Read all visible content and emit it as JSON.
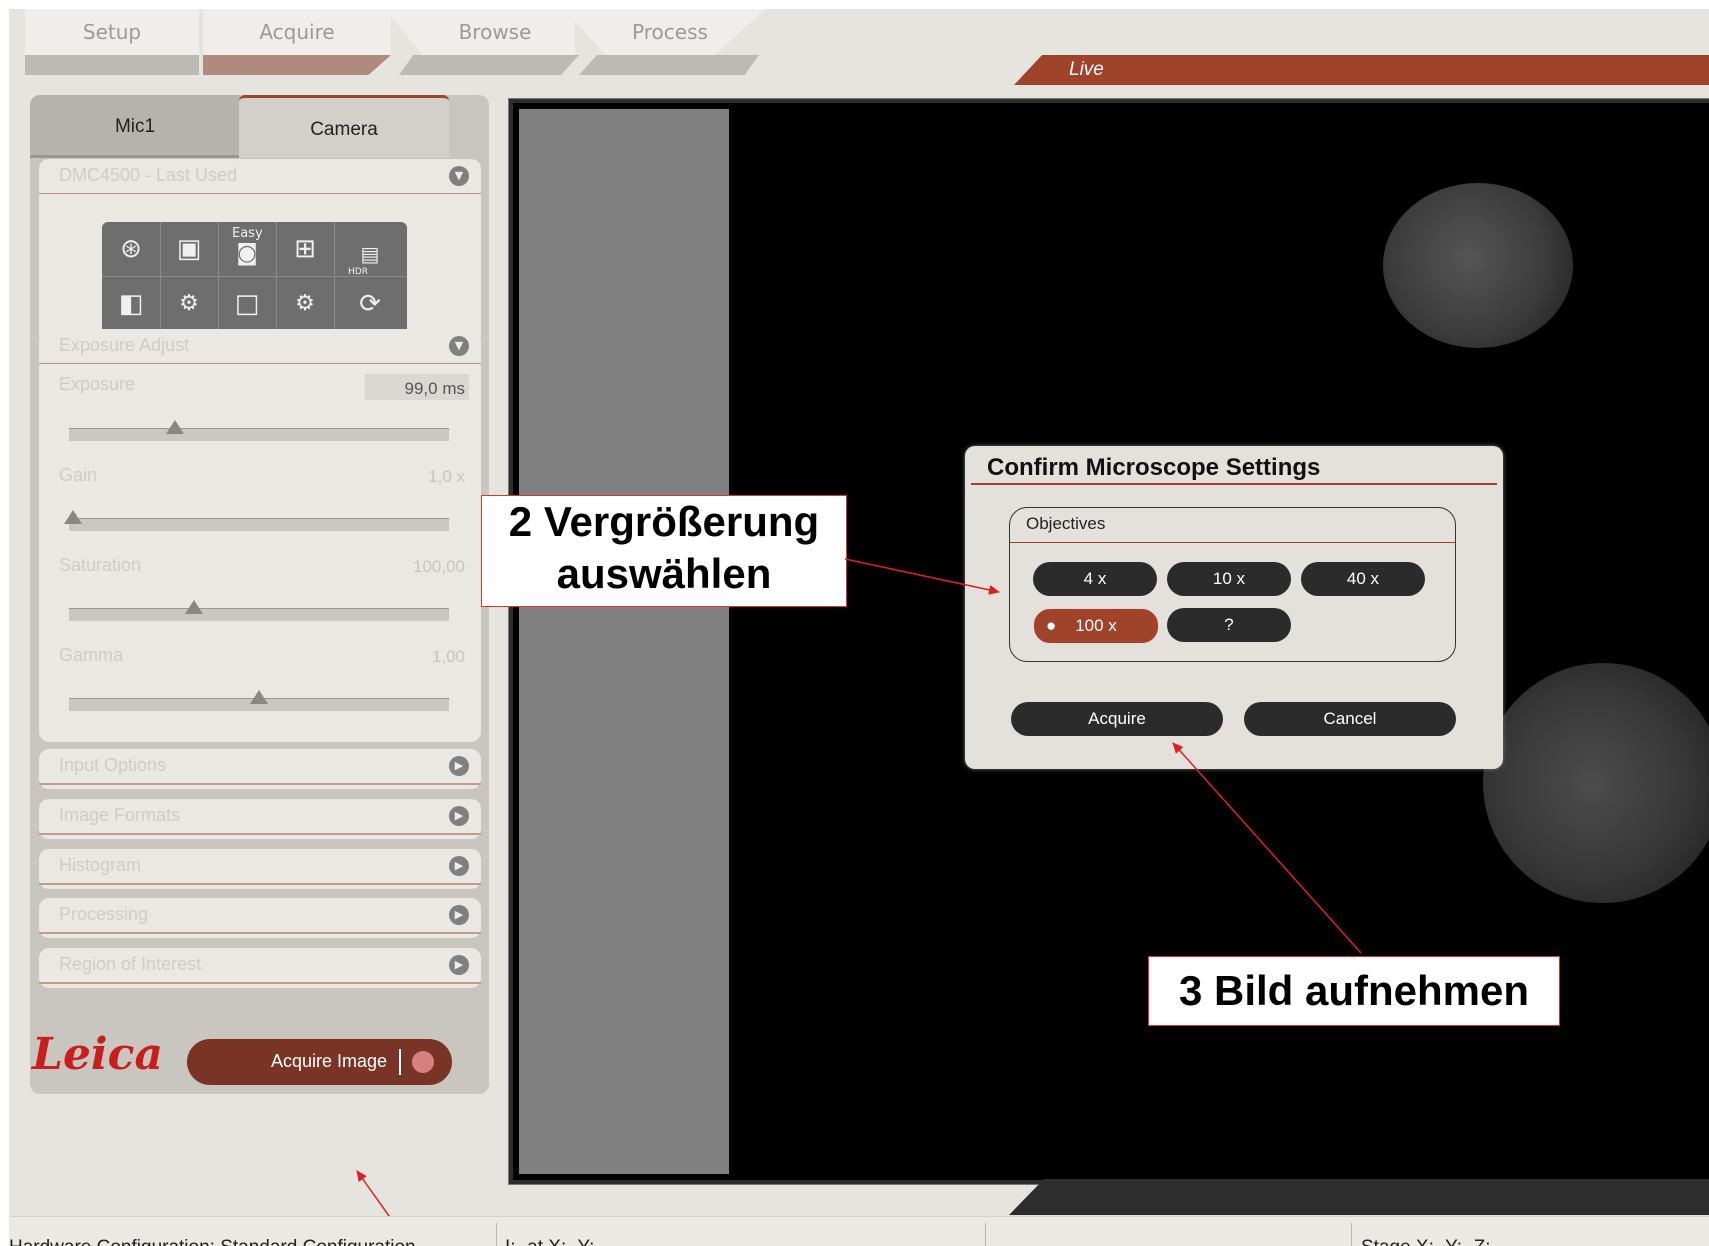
{
  "nav_tabs": [
    {
      "label": "Setup"
    },
    {
      "label": "Acquire"
    },
    {
      "label": "Browse"
    },
    {
      "label": "Process"
    }
  ],
  "live_label": "Live",
  "panel_tabs": [
    {
      "label": "Mic1"
    },
    {
      "label": "Camera"
    }
  ],
  "microscope_section": {
    "title": "DMC4500 - Last Used",
    "icons": [
      "aperture-icon",
      "brightfield-icon",
      "easy-camera-icon",
      "capture-settings-icon",
      "hdr-icon",
      "contrast-icon",
      "color-settings-icon",
      "frame-icon",
      "advanced-settings-icon",
      "refresh-icon"
    ],
    "easy_label": "Easy",
    "hdr_label": "HDR"
  },
  "exposure_section": {
    "title": "Exposure Adjust",
    "sliders": [
      {
        "label": "Exposure",
        "value": "99,0 ms",
        "level": 0.28
      },
      {
        "label": "Gain",
        "value": "1,0 x",
        "level": 0.0
      },
      {
        "label": "Saturation",
        "value": "100,00",
        "level": 0.33
      },
      {
        "label": "Gamma",
        "value": "1,00",
        "level": 0.5
      }
    ]
  },
  "collapsed_sections": [
    {
      "title": "Input Options"
    },
    {
      "title": "Image Formats"
    },
    {
      "title": "Histogram"
    },
    {
      "title": "Processing"
    },
    {
      "title": "Region of Interest"
    }
  ],
  "brand": "Leica",
  "acquire_image_button": "Acquire Image",
  "dialog": {
    "title": "Confirm Microscope Settings",
    "group_label": "Objectives",
    "objectives": [
      {
        "label": "4 x",
        "selected": false
      },
      {
        "label": "10 x",
        "selected": false
      },
      {
        "label": "40 x",
        "selected": false
      },
      {
        "label": "100 x",
        "selected": true
      },
      {
        "label": "?",
        "selected": false
      }
    ],
    "acquire_label": "Acquire",
    "cancel_label": "Cancel"
  },
  "annotations": {
    "step2_line1": "2 Vergrößerung",
    "step2_line2": "auswählen",
    "step3": "3 Bild aufnehmen"
  },
  "status_bar": {
    "hardware": "Hardware Configuration: Standard Configuration",
    "position": "I:- at X:- Y:-",
    "stage": "Stage X:- Y:- Z:-"
  },
  "colors": {
    "accent": "#a0432b",
    "panel_bg": "#c9c6bf",
    "viewer_bg": "#000000",
    "annotation_arrow": "#e02020"
  }
}
